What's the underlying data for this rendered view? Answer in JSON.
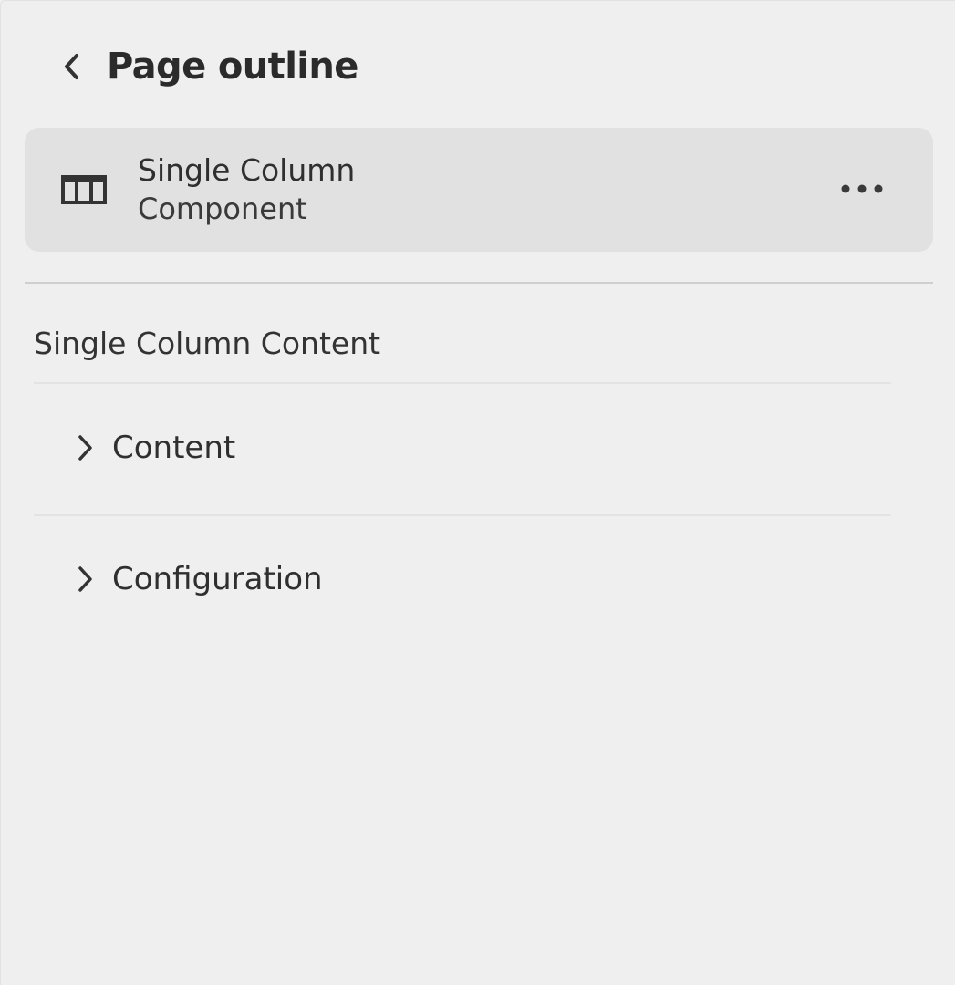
{
  "header": {
    "back_icon": "chevron-left-icon",
    "title": "Page outline"
  },
  "component": {
    "icon": "columns-icon",
    "name": "Single Column",
    "type": "Component",
    "more_icon": "more-horizontal-icon"
  },
  "section": {
    "heading": "Single Column Content",
    "items": [
      {
        "label": "Content",
        "icon": "chevron-right-icon",
        "expanded": false
      },
      {
        "label": "Configuration",
        "icon": "chevron-right-icon",
        "expanded": false
      }
    ]
  },
  "colors": {
    "background": "#efefef",
    "card": "#e1e1e1",
    "text": "#2e2e2e"
  }
}
